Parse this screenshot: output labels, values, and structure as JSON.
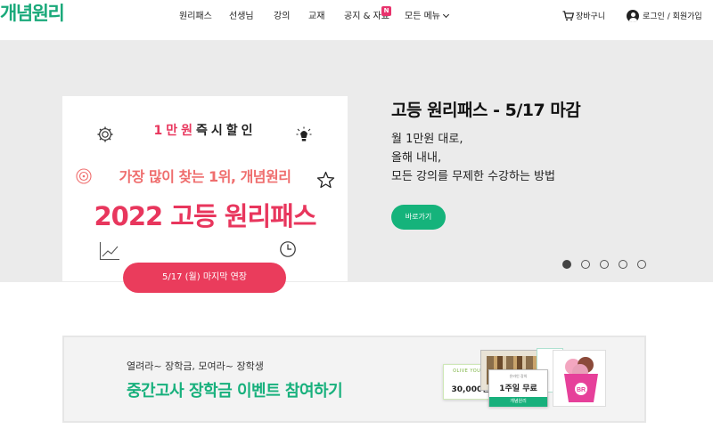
{
  "header": {
    "logo": "개념원리",
    "nav": [
      "원리패스",
      "선생님",
      "강의",
      "교재",
      "공지 & 자료",
      "모든 메뉴"
    ],
    "nav_badge": "N",
    "cart_label": "장바구니",
    "login_label": "로그인 / 회원가입"
  },
  "hero": {
    "card": {
      "discount_amount": "1만원",
      "discount_text": "즉시할인",
      "tagline": "가장 많이 찾는 1위, 개념원리",
      "headline": "2022 고등 원리패스",
      "deadline_button": "5/17 (월) 마지막 연장"
    },
    "title": "고등 원리패스 - 5/17 마감",
    "description": [
      "월 1만원 대로,",
      "올해 내내,",
      "모든 강의를 무제한 수강하는 방법"
    ],
    "cta_label": "바로가기",
    "slides_total": 5,
    "active_slide": 1
  },
  "event_banner": {
    "subtitle": "열려라~ 장학금, 모여라~ 장학생",
    "title": "중간고사 장학금 이벤트 참여하기",
    "coupon_brand": "OLIVE YOUNG",
    "coupon_amount": "30,000원",
    "ticket_top": "온라인 강의",
    "ticket_text": "1주일 무료",
    "ticket_footer": "개념원리"
  },
  "colors": {
    "brand_green": "#1aa97a",
    "accent_red": "#e8365d",
    "cta_green": "#15b37b",
    "hero_bg": "#ebebeb"
  }
}
